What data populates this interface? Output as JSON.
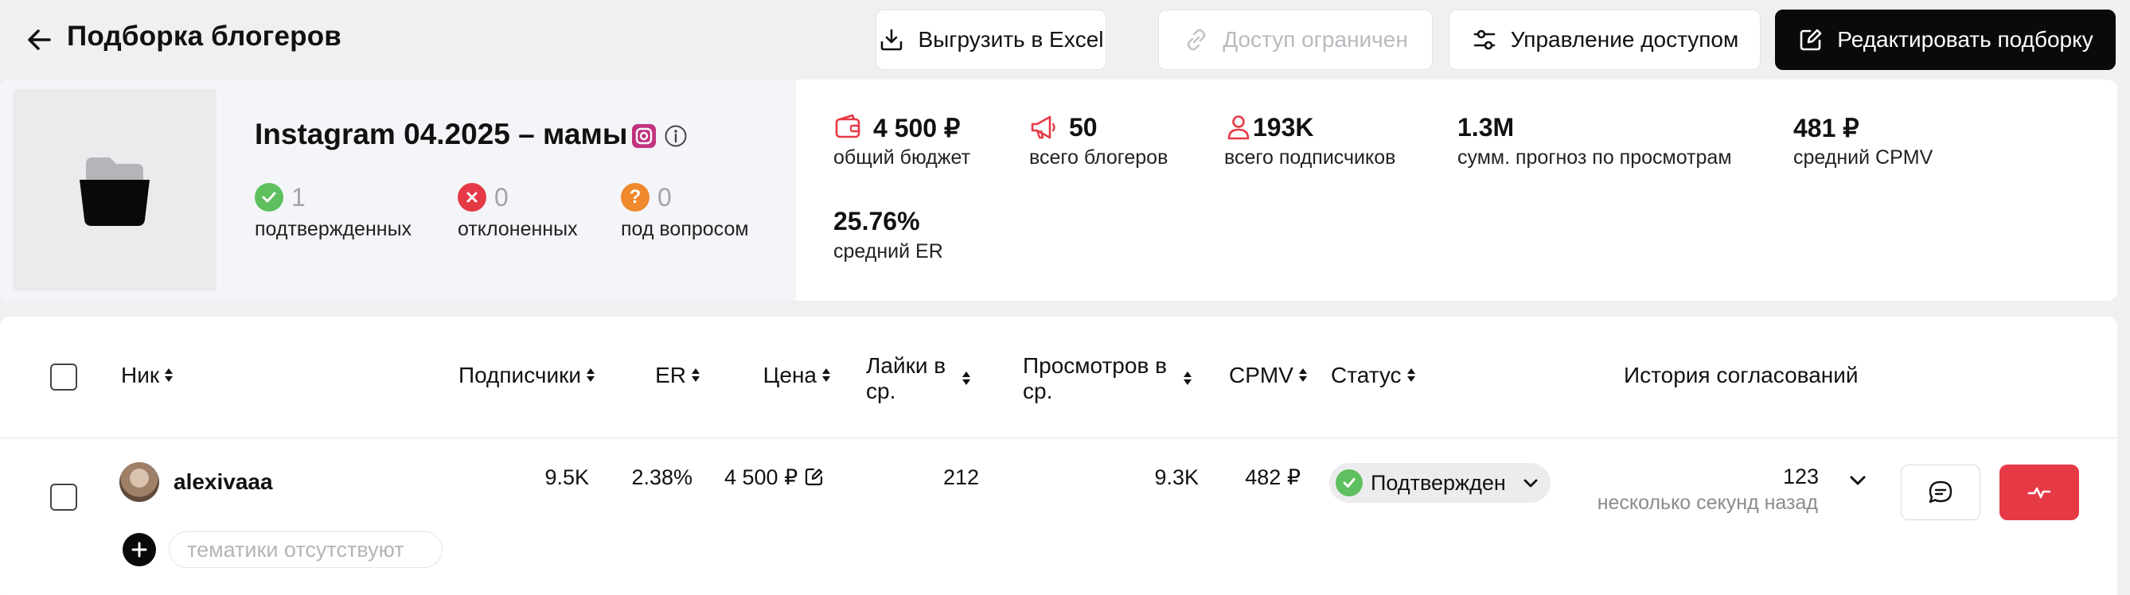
{
  "header": {
    "title": "Подборка блогеров",
    "buttons": {
      "excel": "Выгрузить в Excel",
      "access_limited": "Доступ ограничен",
      "manage_access": "Управление доступом",
      "edit": "Редактировать подборку"
    }
  },
  "collection": {
    "title": "Instagram 04.2025 – мамы",
    "platform_icon": "instagram-icon",
    "statuses": [
      {
        "count": "1",
        "label": "подтвержденных",
        "color": "#5ec05e",
        "icon": "check-icon"
      },
      {
        "count": "0",
        "label": "отклоненных",
        "color": "#e63946",
        "icon": "cross-icon"
      },
      {
        "count": "0",
        "label": "под вопросом",
        "color": "#f0892b",
        "icon": "question-icon"
      }
    ],
    "metrics": [
      {
        "value": "4 500 ₽",
        "label": "общий бюджет",
        "icon": "wallet-icon"
      },
      {
        "value": "50",
        "label": "всего блогеров",
        "icon": "megaphone-icon"
      },
      {
        "value": "193K",
        "label": "всего подписчиков",
        "icon": "user-icon"
      },
      {
        "value": "1.3M",
        "label": "сумм. прогноз по просмотрам"
      },
      {
        "value": "481 ₽",
        "label": "средний CPMV"
      },
      {
        "value": "25.76%",
        "label": "средний ER"
      }
    ],
    "accent_color": "#e63946"
  },
  "table": {
    "columns": {
      "nick": "Ник",
      "subscribers": "Подписчики",
      "er": "ER",
      "price": "Цена",
      "likes_1": "Лайки в",
      "likes_2": "ср.",
      "views_1": "Просмотров в",
      "views_2": "ср.",
      "cpmv": "CPMV",
      "status": "Статус",
      "history": "История согласований"
    },
    "rows": [
      {
        "nick": "alexivaaa",
        "subscribers": "9.5K",
        "er": "2.38%",
        "price": "4 500 ₽",
        "likes": "212",
        "views": "9.3K",
        "cpmv": "482 ₽",
        "status": "Подтвержден",
        "history_count": "123",
        "history_time": "несколько секунд назад",
        "tags_placeholder": "тематики отсутствуют"
      }
    ]
  }
}
